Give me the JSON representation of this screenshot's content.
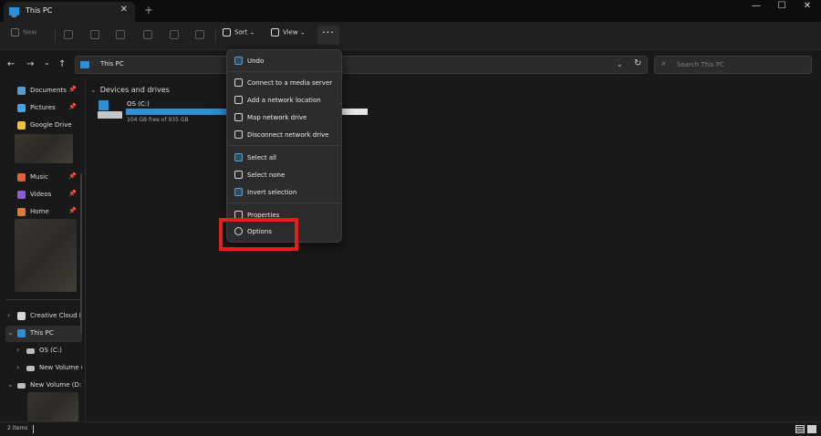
{
  "window": {
    "tab_title": "This PC",
    "tab_close_glyph": "✕",
    "new_tab_glyph": "+",
    "minimize_glyph": "—",
    "maximize_glyph": "☐",
    "close_glyph": "✕"
  },
  "toolbar": {
    "new_label": "New",
    "sort_label": "Sort",
    "view_label": "View",
    "see_more_glyph": "···",
    "colors": {
      "accent": "#2d8fd5",
      "background": "#191919",
      "menu": "#2c2c2c",
      "highlight": "#e01f1f"
    }
  },
  "address_bar": {
    "path": "This PC",
    "search_placeholder": "Search This PC",
    "back_glyph": "←",
    "forward_glyph": "→",
    "recent_glyph": "⌄",
    "up_glyph": "↑",
    "dropdown_glyph": "⌄",
    "refresh_glyph": "↻",
    "search_glyph": "⌕"
  },
  "sidebar": {
    "pin_glyph": "📌",
    "chevron_right": "›",
    "chevron_down": "⌄",
    "items": [
      {
        "label": "Documents",
        "icon": "documents-icon",
        "color": "#5b9bd5"
      },
      {
        "label": "Pictures",
        "icon": "pictures-icon",
        "color": "#4aa3e0"
      },
      {
        "label": "Google Drive",
        "icon": "google-drive-icon",
        "color": "#f1c232"
      },
      {
        "label": "Music",
        "icon": "music-icon",
        "color": "#e0603a"
      },
      {
        "label": "Videos",
        "icon": "videos-icon",
        "color": "#8a5cd6"
      },
      {
        "label": "Home",
        "icon": "home-icon",
        "color": "#e07a3a"
      },
      {
        "label": "Creative Cloud F",
        "icon": "creative-cloud-icon",
        "color": "#d6d6d6"
      },
      {
        "label": "This PC",
        "icon": "this-pc-icon",
        "color": "#2d8fd5"
      },
      {
        "label": "OS (C:)",
        "icon": "drive-icon",
        "color": "#bdbdbd"
      },
      {
        "label": "New Volume (",
        "icon": "drive-icon",
        "color": "#bdbdbd"
      },
      {
        "label": "New Volume (D:",
        "icon": "drive-icon",
        "color": "#bdbdbd"
      }
    ]
  },
  "content": {
    "section_title": "Devices and drives",
    "section_chevron": "⌄",
    "drive": {
      "name": "OS (C:)",
      "free_text": "104 GB free of 935 GB",
      "used_fraction": 0.889
    }
  },
  "menu": {
    "items": [
      {
        "label": "Undo",
        "icon": "undo-icon"
      },
      {
        "label": "Connect to a media server",
        "icon": "media-server-icon"
      },
      {
        "label": "Add a network location",
        "icon": "network-location-icon"
      },
      {
        "label": "Map network drive",
        "icon": "map-drive-icon"
      },
      {
        "label": "Disconnect network drive",
        "icon": "disconnect-drive-icon"
      },
      {
        "label": "Select all",
        "icon": "select-all-icon"
      },
      {
        "label": "Select none",
        "icon": "select-none-icon"
      },
      {
        "label": "Invert selection",
        "icon": "invert-selection-icon"
      },
      {
        "label": "Properties",
        "icon": "properties-icon"
      },
      {
        "label": "Options",
        "icon": "options-icon"
      }
    ]
  },
  "status": {
    "item_count": "2 items"
  }
}
